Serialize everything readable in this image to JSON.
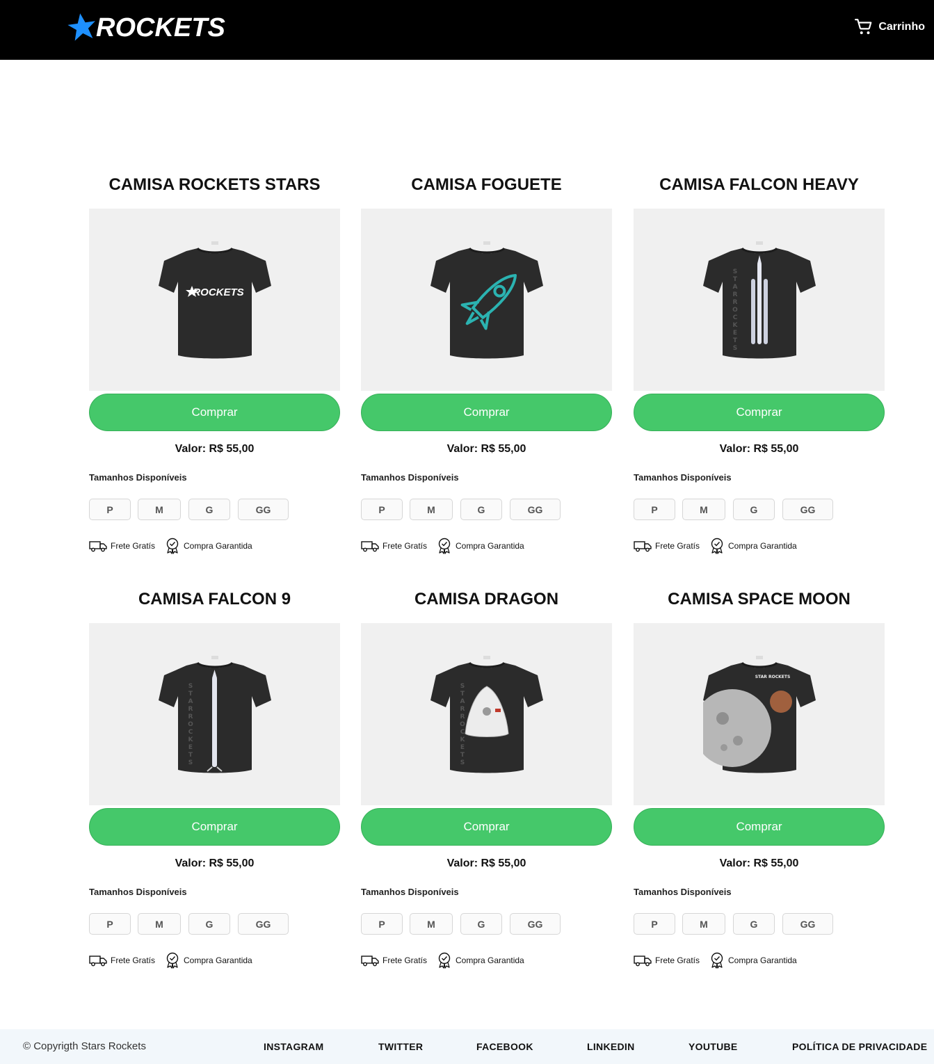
{
  "header": {
    "logo_text": "ROCKETS",
    "cart_label": "Carrinho",
    "colors": {
      "background": "#000000",
      "logo_star": "#1e90ff",
      "text": "#ffffff"
    }
  },
  "products": [
    {
      "title": "CAMISA ROCKETS STARS",
      "design": "rockets-logo-print",
      "buy_label": "Comprar",
      "price": "Valor: R$ 55,00",
      "sizes_label": "Tamanhos Disponíveis",
      "sizes": [
        "P",
        "M",
        "G",
        "GG"
      ],
      "shipping": "Frete Gratís",
      "guarantee": "Compra Garantida"
    },
    {
      "title": "CAMISA FOGUETE",
      "design": "rocket-outline-print",
      "buy_label": "Comprar",
      "price": "Valor: R$ 55,00",
      "sizes_label": "Tamanhos Disponíveis",
      "sizes": [
        "P",
        "M",
        "G",
        "GG"
      ],
      "shipping": "Frete Gratís",
      "guarantee": "Compra Garantida"
    },
    {
      "title": "CAMISA FALCON HEAVY",
      "design": "falcon-heavy-print",
      "buy_label": "Comprar",
      "price": "Valor: R$ 55,00",
      "sizes_label": "Tamanhos Disponíveis",
      "sizes": [
        "P",
        "M",
        "G",
        "GG"
      ],
      "shipping": "Frete Gratís",
      "guarantee": "Compra Garantida"
    },
    {
      "title": "CAMISA FALCON 9",
      "design": "falcon-9-print",
      "buy_label": "Comprar",
      "price": "Valor: R$ 55,00",
      "sizes_label": "Tamanhos Disponíveis",
      "sizes": [
        "P",
        "M",
        "G",
        "GG"
      ],
      "shipping": "Frete Gratís",
      "guarantee": "Compra Garantida"
    },
    {
      "title": "CAMISA DRAGON",
      "design": "dragon-capsule-print",
      "buy_label": "Comprar",
      "price": "Valor: R$ 55,00",
      "sizes_label": "Tamanhos Disponíveis",
      "sizes": [
        "P",
        "M",
        "G",
        "GG"
      ],
      "shipping": "Frete Gratís",
      "guarantee": "Compra Garantida"
    },
    {
      "title": "CAMISA SPACE MOON",
      "design": "moon-planet-print",
      "buy_label": "Comprar",
      "price": "Valor: R$ 55,00",
      "sizes_label": "Tamanhos Disponíveis",
      "sizes": [
        "P",
        "M",
        "G",
        "GG"
      ],
      "shipping": "Frete Gratís",
      "guarantee": "Compra Garantida"
    }
  ],
  "print_text": {
    "vertical": "STARROCKETS",
    "moon_brand": "STAR ROCKETS",
    "shirt_logo": "ROCKETS"
  },
  "colors": {
    "buy_button": "#45c86a",
    "image_background": "#f0f0f0",
    "shirt": "#2b2b2b",
    "rocket_outline": "#2bb3b1"
  },
  "footer": {
    "copyright": "© Copyrigth Stars Rockets",
    "links": [
      "INSTAGRAM",
      "TWITTER",
      "FACEBOOK",
      "LINKEDIN",
      "YOUTUBE",
      "POLÍTICA DE PRIVACIDADE"
    ]
  }
}
